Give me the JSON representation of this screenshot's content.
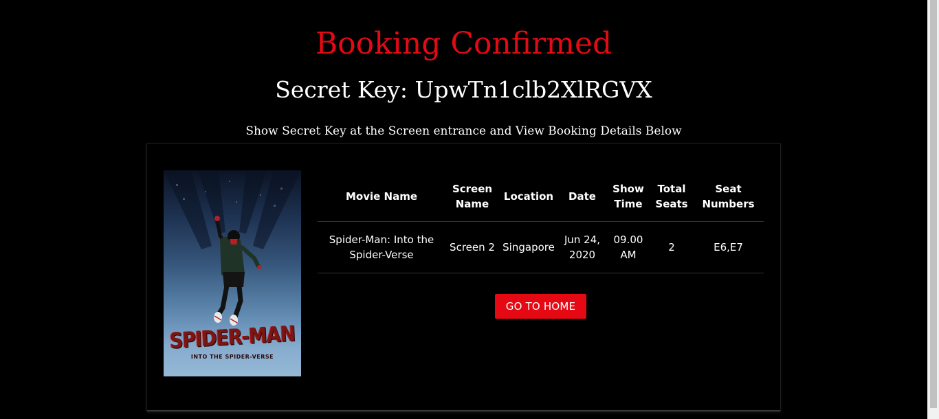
{
  "header": {
    "title": "Booking Confirmed",
    "secret_key_label": "Secret Key: UpwTn1clb2XlRGVX",
    "instructions": "Show Secret Key at the Screen entrance and View Booking Details Below"
  },
  "poster": {
    "title": "SPIDER-MAN",
    "subtitle": "INTO THE SPIDER-VERSE"
  },
  "booking_table": {
    "headers": {
      "movie_name": "Movie Name",
      "screen_name": "Screen Name",
      "location": "Location",
      "date": "Date",
      "show_time": "Show Time",
      "total_seats": "Total Seats",
      "seat_numbers": "Seat Numbers"
    },
    "row": {
      "movie_name": "Spider-Man: Into the Spider-Verse",
      "screen_name": "Screen 2",
      "location": "Singapore",
      "date": "Jun 24, 2020",
      "show_time": "09.00 AM",
      "total_seats": "2",
      "seat_numbers": "E6,E7"
    }
  },
  "actions": {
    "home_button": "GO TO HOME"
  },
  "colors": {
    "accent": "#e50914",
    "background": "#000000",
    "text": "#ffffff"
  }
}
